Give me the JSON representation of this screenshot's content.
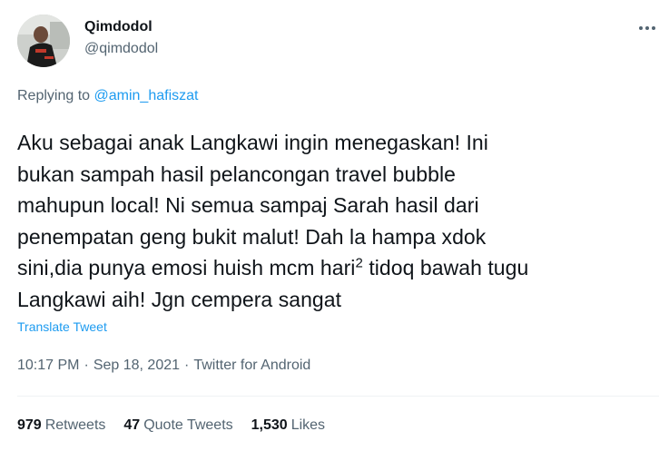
{
  "tweet": {
    "author": {
      "display_name": "Qimdodol",
      "handle": "@qimdodol",
      "avatar_icon": "user-avatar-photo"
    },
    "more_icon": "more-horizontal-icon",
    "replying": {
      "prefix": "Replying to",
      "mention": "@amin_hafiszat"
    },
    "text_lines": [
      "Aku sebagai anak Langkawi ingin menegaskan! Ini",
      "bukan sampah hasil pelancongan travel bubble",
      "mahupun local! Ni semua sampaj Sarah hasil dari",
      "penempatan geng bukit malut! Dah la hampa xdok",
      "sini,dia punya emosi huish mcm hari",
      "2",
      " tidoq bawah tugu",
      "Langkawi aih! Jgn cempera sangat"
    ],
    "translate_label": "Translate Tweet",
    "meta": {
      "time": "10:17 PM",
      "separator": "·",
      "date": "Sep 18, 2021",
      "source": "Twitter for Android"
    },
    "stats": {
      "retweets_count": "979",
      "retweets_label": "Retweets",
      "quotes_count": "47",
      "quotes_label": "Quote Tweets",
      "likes_count": "1,530",
      "likes_label": "Likes"
    },
    "colors": {
      "link": "#1d9bf0",
      "secondary_text": "#536471",
      "primary_text": "#0f1419",
      "divider": "#eff3f4"
    }
  }
}
